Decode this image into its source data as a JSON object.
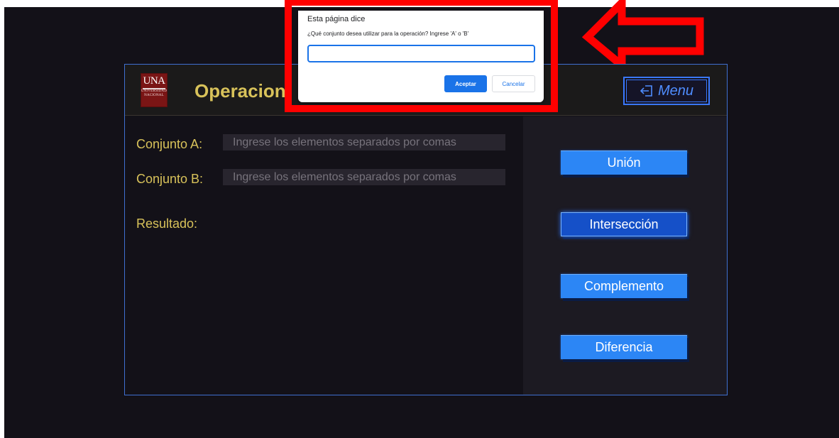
{
  "header": {
    "logo_text": "UNA",
    "logo_subtext_1": "UNIVERSIDAD",
    "logo_subtext_2": "NACIONAL",
    "title": "Operacion",
    "menu_label": "Menu",
    "menu_icon": "sign-out-icon"
  },
  "form": {
    "set_a_label": "Conjunto A:",
    "set_a_placeholder": "Ingrese los elementos separados por comas",
    "set_b_label": "Conjunto B:",
    "set_b_placeholder": "Ingrese los elementos separados por comas",
    "result_label": "Resultado:"
  },
  "operations": [
    {
      "label": "Unión",
      "active": false
    },
    {
      "label": "Intersección",
      "active": true
    },
    {
      "label": "Complemento",
      "active": false
    },
    {
      "label": "Diferencia",
      "active": false
    }
  ],
  "prompt": {
    "title": "Esta página dice",
    "message": "¿Qué conjunto desea utilizar para la operación? Ingrese 'A' o 'B'",
    "input_value": "",
    "accept_label": "Aceptar",
    "cancel_label": "Cancelar"
  },
  "colors": {
    "accent_blue": "#2c86f5",
    "title_gold": "#d8c25a",
    "highlight_red": "#ff0000"
  }
}
